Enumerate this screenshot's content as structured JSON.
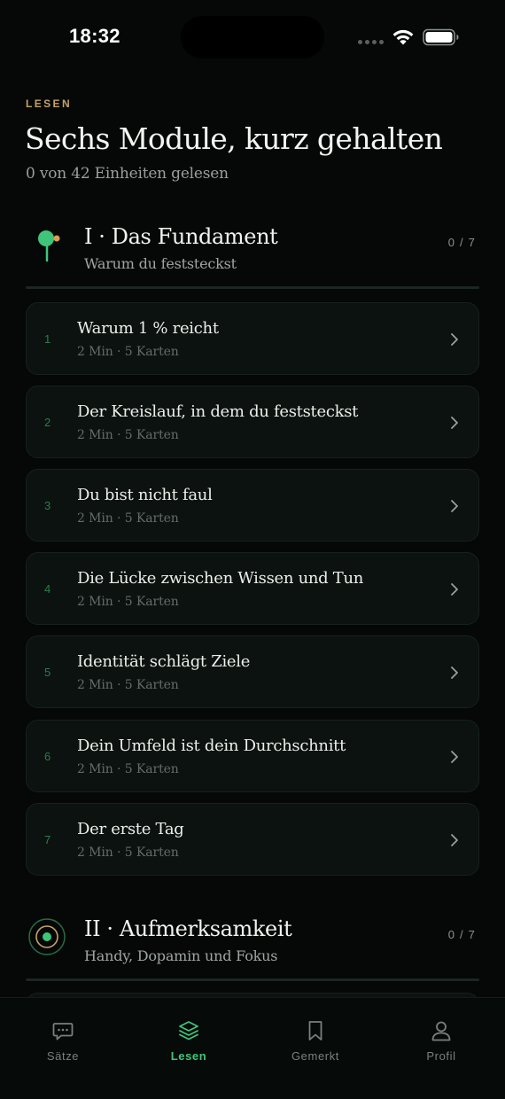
{
  "status_bar": {
    "time": "18:32"
  },
  "header": {
    "eyebrow": "LESEN",
    "title": "Sechs Module, kurz gehalten",
    "subtitle": "0 von 42 Einheiten gelesen"
  },
  "modules": [
    {
      "title": "I · Das Fundament",
      "subtitle": "Warum du feststeckst",
      "progress": "0 / 7",
      "icon": "sapling-icon",
      "lessons": [
        {
          "number": "1",
          "title": "Warum 1 % reicht",
          "meta": "2 Min · 5 Karten"
        },
        {
          "number": "2",
          "title": "Der Kreislauf, in dem du feststeckst",
          "meta": "2 Min · 5 Karten"
        },
        {
          "number": "3",
          "title": "Du bist nicht faul",
          "meta": "2 Min · 5 Karten"
        },
        {
          "number": "4",
          "title": "Die Lücke zwischen Wissen und Tun",
          "meta": "2 Min · 5 Karten"
        },
        {
          "number": "5",
          "title": "Identität schlägt Ziele",
          "meta": "2 Min · 5 Karten"
        },
        {
          "number": "6",
          "title": "Dein Umfeld ist dein Durchschnitt",
          "meta": "2 Min · 5 Karten"
        },
        {
          "number": "7",
          "title": "Der erste Tag",
          "meta": "2 Min · 5 Karten"
        }
      ]
    },
    {
      "title": "II · Aufmerksamkeit",
      "subtitle": "Handy, Dopamin und Fokus",
      "progress": "0 / 7",
      "icon": "focus-target-icon"
    }
  ],
  "tab_bar": {
    "tabs": [
      {
        "label": "Sätze",
        "icon": "chat-bubble-icon",
        "active": false
      },
      {
        "label": "Lesen",
        "icon": "layers-icon",
        "active": true
      },
      {
        "label": "Gemerkt",
        "icon": "bookmark-icon",
        "active": false
      },
      {
        "label": "Profil",
        "icon": "person-icon",
        "active": false
      }
    ]
  },
  "colors": {
    "background": "#050807",
    "accent_green": "#3fc57a",
    "eyebrow_gold": "#c3a26a",
    "card_background": "#0b1210"
  }
}
